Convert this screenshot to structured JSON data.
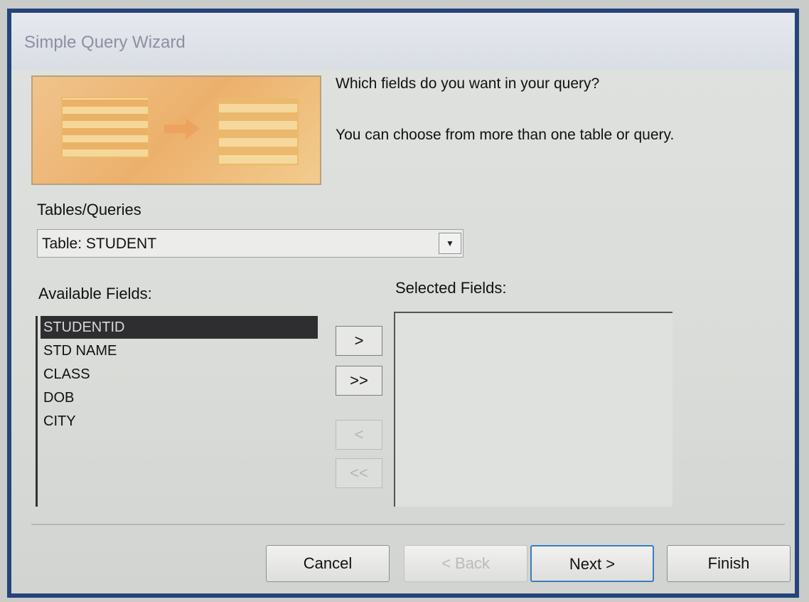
{
  "window": {
    "title": "Simple Query Wizard"
  },
  "intro": {
    "question": "Which fields do you want in your query?",
    "hint": "You can choose from more than one table or query."
  },
  "tables_queries": {
    "label": "Tables/Queries",
    "value": "Table: STUDENT"
  },
  "available_fields": {
    "label": "Available Fields:",
    "items": [
      "STUDENTID",
      "STD NAME",
      "CLASS",
      "DOB",
      "CITY"
    ],
    "selected_index": 0
  },
  "selected_fields": {
    "label": "Selected Fields:",
    "items": []
  },
  "move_buttons": {
    "add_one": ">",
    "add_all": ">>",
    "remove_one": "<",
    "remove_all": "<<"
  },
  "footer": {
    "cancel": "Cancel",
    "back": "< Back",
    "next": "Next >",
    "finish": "Finish"
  }
}
